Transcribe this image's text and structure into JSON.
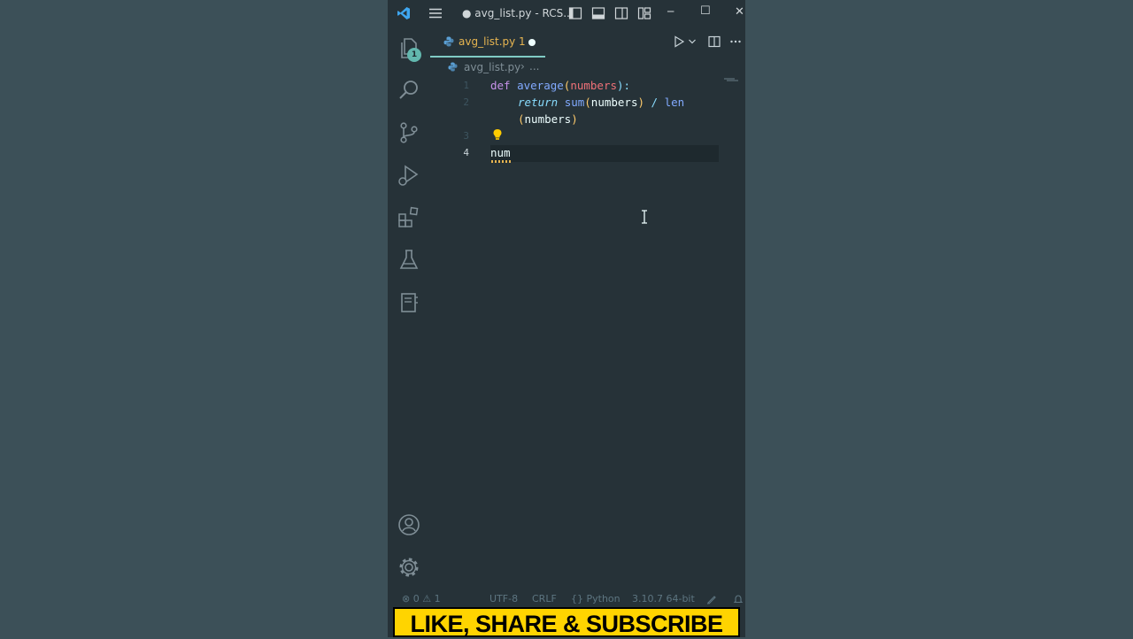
{
  "window": {
    "title": "● avg_list.py - RCS...",
    "minimize_glyph": "─",
    "maximize_glyph": "☐",
    "close_glyph": "✕"
  },
  "activity_bar": {
    "explorer_badge": "1",
    "items": [
      "explorer-icon",
      "search-icon",
      "source-control-icon",
      "run-debug-icon",
      "extensions-icon",
      "testing-icon",
      "notebook-icon",
      "account-icon",
      "settings-gear-icon"
    ]
  },
  "tab": {
    "label": "avg_list.py 1",
    "modified": true
  },
  "breadcrumb": {
    "file": "avg_list.py",
    "separator": "›",
    "more": "..."
  },
  "editor": {
    "line_numbers": [
      "1",
      "2",
      "3",
      "4"
    ],
    "lines": {
      "l1": [
        "def",
        "average",
        "(",
        "numbers",
        "):"
      ],
      "l2": [
        "return",
        "sum",
        "(",
        "numbers",
        ")",
        " / ",
        "len"
      ],
      "l2b": [
        "(",
        "numbers",
        ")"
      ],
      "l4": "num"
    }
  },
  "status_bar": {
    "errors": "0",
    "warnings": "1",
    "encoding": "UTF-8",
    "eol": "CRLF",
    "language": "Python",
    "interpreter": "3.10.7 64-bit"
  },
  "banner": {
    "text": "LIKE, SHARE & SUBSCRIBE"
  },
  "colors": {
    "editor_bg": "#263238",
    "page_bg": "#3c5058",
    "accent": "#80cbc4",
    "banner_bg": "#ffd400"
  }
}
